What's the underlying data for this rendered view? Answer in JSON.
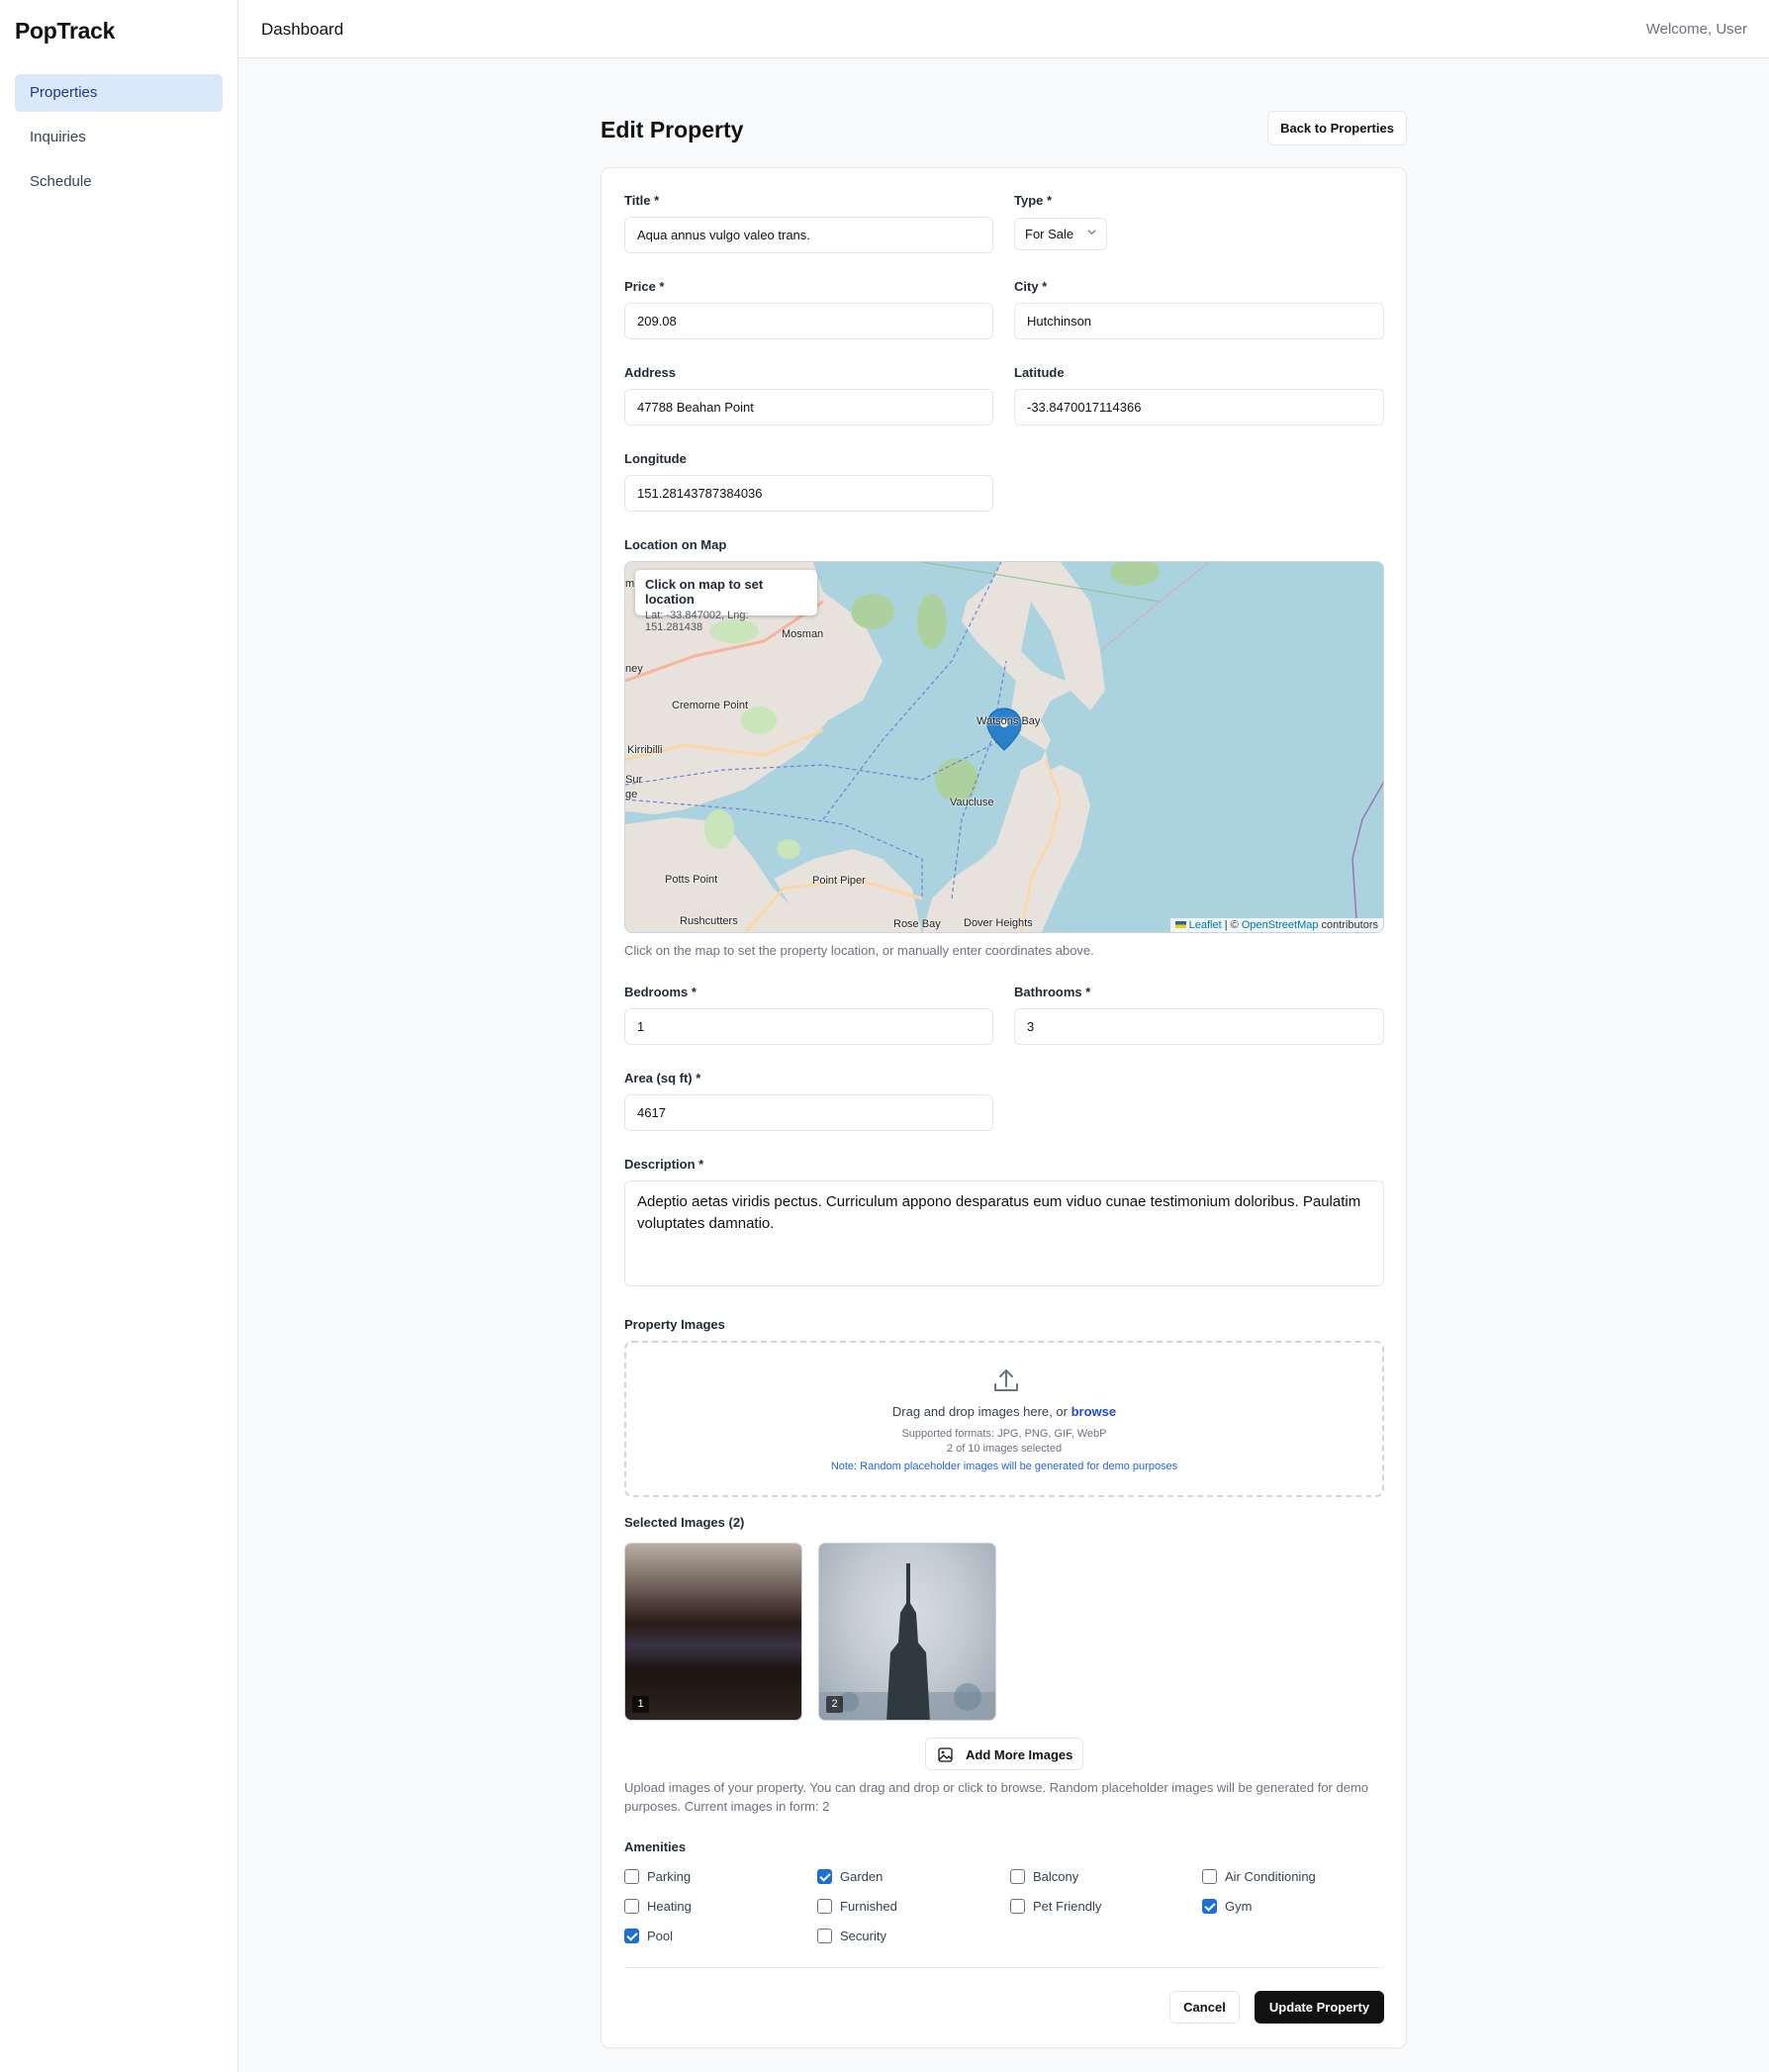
{
  "app": {
    "brand": "PopTrack",
    "header_title": "Dashboard",
    "welcome": "Welcome, User"
  },
  "sidebar": {
    "items": [
      {
        "label": "Properties",
        "active": true
      },
      {
        "label": "Inquiries",
        "active": false
      },
      {
        "label": "Schedule",
        "active": false
      }
    ]
  },
  "page": {
    "title": "Edit Property",
    "back_button": "Back to Properties"
  },
  "form": {
    "title": {
      "label": "Title *",
      "value": "Aqua annus vulgo valeo trans."
    },
    "type": {
      "label": "Type *",
      "value": "For Sale"
    },
    "price": {
      "label": "Price *",
      "value": "209.08"
    },
    "city": {
      "label": "City *",
      "value": "Hutchinson"
    },
    "address": {
      "label": "Address",
      "value": "47788 Beahan Point"
    },
    "latitude": {
      "label": "Latitude",
      "value": "-33.8470017114366"
    },
    "longitude": {
      "label": "Longitude",
      "value": "151.28143787384036"
    },
    "map": {
      "label": "Location on Map",
      "info_title": "Click on map to set location",
      "info_coords": "Lat: -33.847002, Lng: 151.281438",
      "attr_leaflet": "Leaflet",
      "attr_sep": " | © ",
      "attr_osm": "OpenStreetMap",
      "attr_contrib": " contributors",
      "helper": "Click on the map to set the property location, or manually enter coordinates above.",
      "places": [
        "Mosman",
        "Cremorne Point",
        "Kirribilli",
        "Watsons Bay",
        "Vaucluse",
        "Potts Point",
        "Point Piper",
        "Rushcutters",
        "Rose Bay",
        "Dover Heights",
        "ney",
        "Sur",
        "ge",
        "m"
      ]
    },
    "bedrooms": {
      "label": "Bedrooms *",
      "value": "1"
    },
    "bathrooms": {
      "label": "Bathrooms *",
      "value": "3"
    },
    "area": {
      "label": "Area (sq ft) *",
      "value": "4617"
    },
    "description": {
      "label": "Description *",
      "value": "Adeptio aetas viridis pectus. Curriculum appono desparatus eum viduo cunae testimonium doloribus. Paulatim voluptates damnatio."
    },
    "images": {
      "label": "Property Images",
      "drop_text": "Drag and drop images here, or ",
      "browse": "browse",
      "formats": "Supported formats: JPG, PNG, GIF, WebP",
      "count": "2 of 10 images selected",
      "note": "Note: Random placeholder images will be generated for demo purposes",
      "selected_label": "Selected Images (2)",
      "thumbs": [
        "1",
        "2"
      ],
      "add_more": "Add More Images",
      "helper": "Upload images of your property. You can drag and drop or click to browse. Random placeholder images will be generated for demo purposes. Current images in form: 2"
    },
    "amenities": {
      "label": "Amenities",
      "items": [
        {
          "label": "Parking",
          "checked": false
        },
        {
          "label": "Garden",
          "checked": true
        },
        {
          "label": "Balcony",
          "checked": false
        },
        {
          "label": "Air Conditioning",
          "checked": false
        },
        {
          "label": "Heating",
          "checked": false
        },
        {
          "label": "Furnished",
          "checked": false
        },
        {
          "label": "Pet Friendly",
          "checked": false
        },
        {
          "label": "Gym",
          "checked": true
        },
        {
          "label": "Pool",
          "checked": true
        },
        {
          "label": "Security",
          "checked": false
        }
      ]
    },
    "cancel": "Cancel",
    "submit": "Update Property"
  },
  "colors": {
    "accent": "#1d6fd6",
    "primary_button": "#111111",
    "nav_active_bg": "#dbe8fb",
    "water": "#aad3df"
  }
}
